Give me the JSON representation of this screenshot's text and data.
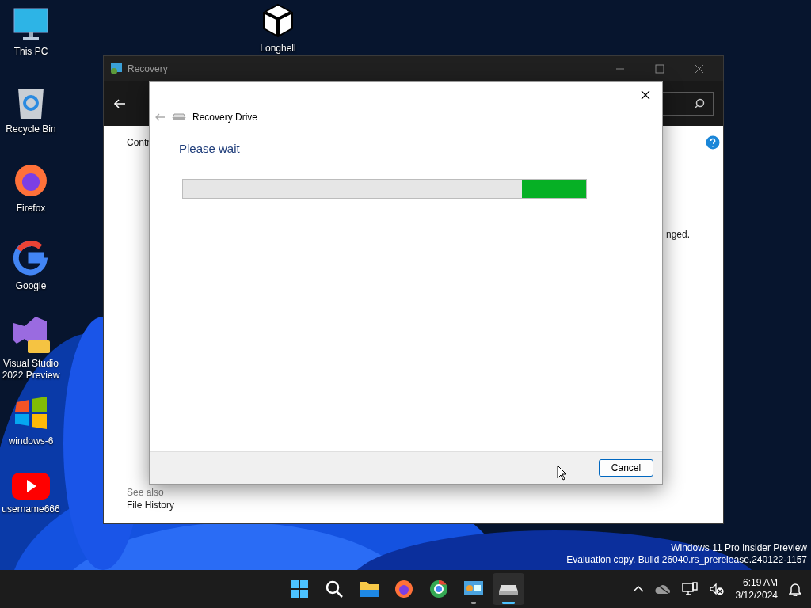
{
  "desktop_icons": [
    {
      "kind": "monitor",
      "label": "This PC"
    },
    {
      "kind": "recycle-bin",
      "label": "Recycle Bin"
    },
    {
      "kind": "firefox",
      "label": "Firefox"
    },
    {
      "kind": "google",
      "label": "Google"
    },
    {
      "kind": "visual-studio",
      "label": "Visual Studio 2022 Preview"
    },
    {
      "kind": "windows-flag",
      "label": "windows-6"
    },
    {
      "kind": "youtube",
      "label": "username666"
    }
  ],
  "desktop_shortcut": {
    "kind": "unity",
    "label": "Longhell"
  },
  "background_window": {
    "title": "Recovery",
    "breadcrumb": "Contr",
    "text_fragment": "nged.",
    "see_also": {
      "heading": "See also",
      "links": [
        "File History"
      ]
    }
  },
  "dialog": {
    "title": "Recovery Drive",
    "heading": "Please wait",
    "progress": {
      "kind": "marquee",
      "level": 0.16
    },
    "buttons": [
      "Cancel"
    ]
  },
  "evaluation_notice": [
    "Windows 11 Pro Insider Preview",
    "Evaluation copy. Build 26040.rs_prerelease.240122-1157"
  ],
  "taskbar": {
    "apps": [
      {
        "kind": "start",
        "running": false,
        "selected": false
      },
      {
        "kind": "search",
        "running": false,
        "selected": false
      },
      {
        "kind": "folder",
        "running": false,
        "selected": false
      },
      {
        "kind": "firefox",
        "running": false,
        "selected": false
      },
      {
        "kind": "chrome",
        "running": false,
        "selected": false
      },
      {
        "kind": "control-panel",
        "running": true,
        "selected": false
      },
      {
        "kind": "drive",
        "running": true,
        "selected": true
      }
    ],
    "clock": {
      "time": "6:19 AM",
      "date": "3/12/2024"
    }
  }
}
